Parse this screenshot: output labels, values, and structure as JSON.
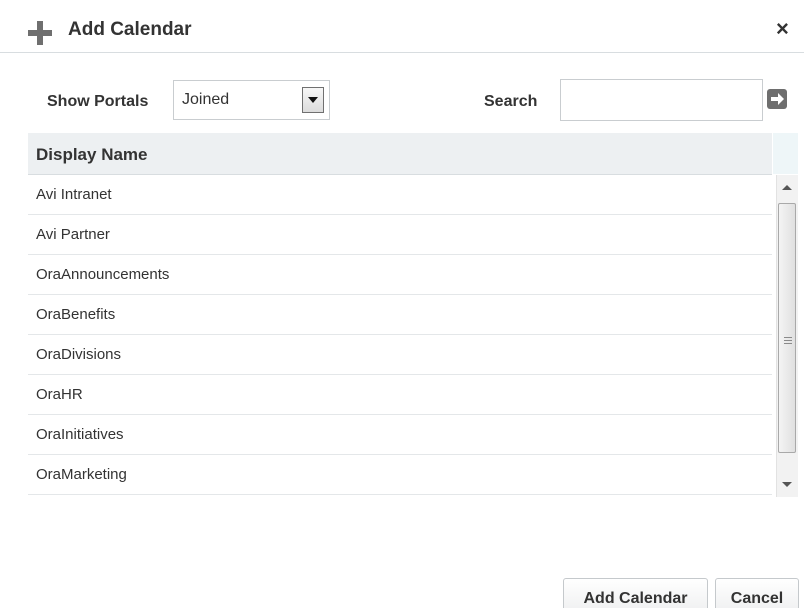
{
  "dialog": {
    "title": "Add Calendar",
    "close_label": "×"
  },
  "toolbar": {
    "show_portals_label": "Show Portals",
    "show_portals_value": "Joined",
    "search_label": "Search",
    "search_value": "",
    "search_placeholder": ""
  },
  "table": {
    "column_header": "Display Name",
    "rows": [
      "Avi Intranet",
      "Avi Partner",
      "OraAnnouncements",
      "OraBenefits",
      "OraDivisions",
      "OraHR",
      "OraInitiatives",
      "OraMarketing"
    ]
  },
  "footer": {
    "add_label": "Add Calendar",
    "cancel_label": "Cancel"
  },
  "icons": {
    "header": "plus-icon",
    "close": "close-icon",
    "search_go": "arrow-right-icon",
    "dropdown": "chevron-down-icon"
  },
  "colors": {
    "header_bg": "#ffffff",
    "table_header_bg": "#edf0f2",
    "border": "#d8dde0",
    "text": "#333333"
  }
}
